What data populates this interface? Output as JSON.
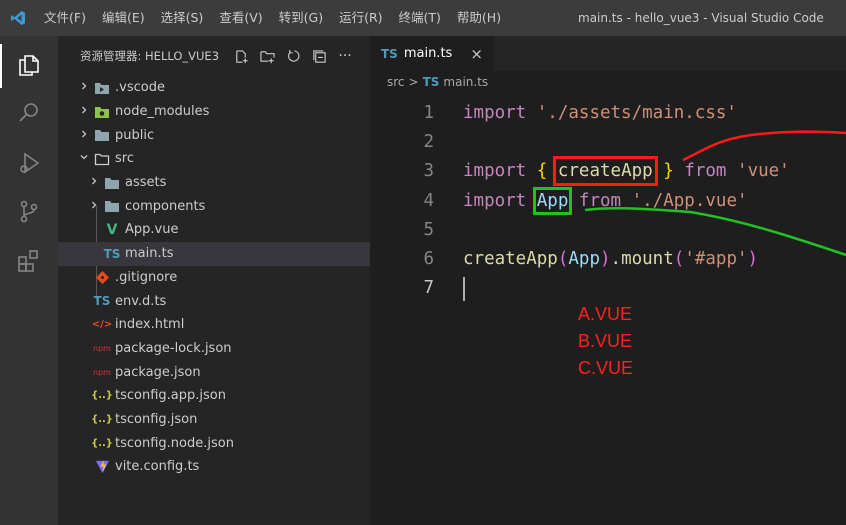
{
  "titlebar": {
    "menu": [
      "文件(F)",
      "编辑(E)",
      "选择(S)",
      "查看(V)",
      "转到(G)",
      "运行(R)",
      "终端(T)",
      "帮助(H)"
    ],
    "window_title": "main.ts - hello_vue3 - Visual Studio Code"
  },
  "activitybar": {
    "icons": [
      "explorer-icon",
      "search-icon",
      "run-debug-icon",
      "source-control-icon",
      "extensions-icon"
    ]
  },
  "sidebar": {
    "title": "资源管理器: HELLO_VUE3",
    "actions": [
      "new-file-icon",
      "new-folder-icon",
      "refresh-icon",
      "collapse-all-icon",
      "more-icon"
    ],
    "tree": [
      {
        "label": ".vscode",
        "kind": "folder",
        "icon": "vscode-folder-icon",
        "expanded": false,
        "depth": 0
      },
      {
        "label": "node_modules",
        "kind": "folder",
        "icon": "node-modules-folder-icon",
        "expanded": false,
        "depth": 0
      },
      {
        "label": "public",
        "kind": "folder",
        "icon": "folder-icon",
        "expanded": false,
        "depth": 0
      },
      {
        "label": "src",
        "kind": "folder",
        "icon": "folder-open-icon",
        "expanded": true,
        "depth": 0
      },
      {
        "label": "assets",
        "kind": "folder",
        "icon": "folder-icon",
        "expanded": false,
        "depth": 1
      },
      {
        "label": "components",
        "kind": "folder",
        "icon": "folder-icon",
        "expanded": false,
        "depth": 1
      },
      {
        "label": "App.vue",
        "kind": "file",
        "icon": "vue-icon",
        "badge": "V",
        "depth": 1
      },
      {
        "label": "main.ts",
        "kind": "file",
        "icon": "typescript-icon",
        "badge": "TS",
        "depth": 1,
        "selected": true
      },
      {
        "label": ".gitignore",
        "kind": "file",
        "icon": "git-icon",
        "depth": 0
      },
      {
        "label": "env.d.ts",
        "kind": "file",
        "icon": "typescript-icon",
        "badge": "TS",
        "depth": 0
      },
      {
        "label": "index.html",
        "kind": "file",
        "icon": "html-icon",
        "badge": "</>",
        "depth": 0
      },
      {
        "label": "package-lock.json",
        "kind": "file",
        "icon": "npm-icon",
        "badge": "npm",
        "depth": 0
      },
      {
        "label": "package.json",
        "kind": "file",
        "icon": "npm-icon",
        "badge": "npm",
        "depth": 0
      },
      {
        "label": "tsconfig.app.json",
        "kind": "file",
        "icon": "json-icon",
        "badge": "{..}",
        "depth": 0
      },
      {
        "label": "tsconfig.json",
        "kind": "file",
        "icon": "json-icon",
        "badge": "{..}",
        "depth": 0
      },
      {
        "label": "tsconfig.node.json",
        "kind": "file",
        "icon": "json-icon",
        "badge": "{..}",
        "depth": 0
      },
      {
        "label": "vite.config.ts",
        "kind": "file",
        "icon": "vite-icon",
        "depth": 0
      }
    ]
  },
  "editor": {
    "tab": {
      "badge": "TS",
      "label": "main.ts",
      "close": "×"
    },
    "breadcrumb": {
      "folder": "src",
      "separator": ">",
      "badge": "TS",
      "file": "main.ts"
    },
    "lines": [
      {
        "n": "1",
        "tokens": [
          [
            "kw",
            "import"
          ],
          [
            "punc",
            " "
          ],
          [
            "str",
            "'./assets/main.css'"
          ]
        ]
      },
      {
        "n": "2",
        "tokens": []
      },
      {
        "n": "3",
        "tokens": [
          [
            "kw",
            "import"
          ],
          [
            "punc",
            " "
          ],
          [
            "brace",
            "{"
          ],
          [
            "punc",
            " "
          ],
          [
            "fn-red",
            "createApp"
          ],
          [
            "punc",
            " "
          ],
          [
            "brace",
            "}"
          ],
          [
            "punc",
            " "
          ],
          [
            "kw",
            "from"
          ],
          [
            "punc",
            " "
          ],
          [
            "str",
            "'vue'"
          ]
        ]
      },
      {
        "n": "4",
        "tokens": [
          [
            "kw",
            "import"
          ],
          [
            "punc",
            " "
          ],
          [
            "var-green",
            "App"
          ],
          [
            "punc",
            " "
          ],
          [
            "kw",
            "from"
          ],
          [
            "punc",
            " "
          ],
          [
            "str",
            "'./App.vue'"
          ]
        ]
      },
      {
        "n": "5",
        "tokens": []
      },
      {
        "n": "6",
        "tokens": [
          [
            "fn",
            "createApp"
          ],
          [
            "paren",
            "("
          ],
          [
            "var",
            "App"
          ],
          [
            "paren",
            ")"
          ],
          [
            "punc",
            "."
          ],
          [
            "fn",
            "mount"
          ],
          [
            "paren",
            "("
          ],
          [
            "str",
            "'#app'"
          ],
          [
            "paren",
            ")"
          ]
        ]
      },
      {
        "n": "7",
        "tokens": [],
        "active": true
      }
    ],
    "annotations": [
      "A.VUE",
      "B.VUE",
      "C.VUE"
    ]
  },
  "colors": {
    "annotation_red": "#ff1a1a",
    "annotation_green": "#22c022",
    "keyword": "#c586c0",
    "string": "#ce9178",
    "function": "#dcdcaa",
    "variable": "#9cdcfe"
  }
}
